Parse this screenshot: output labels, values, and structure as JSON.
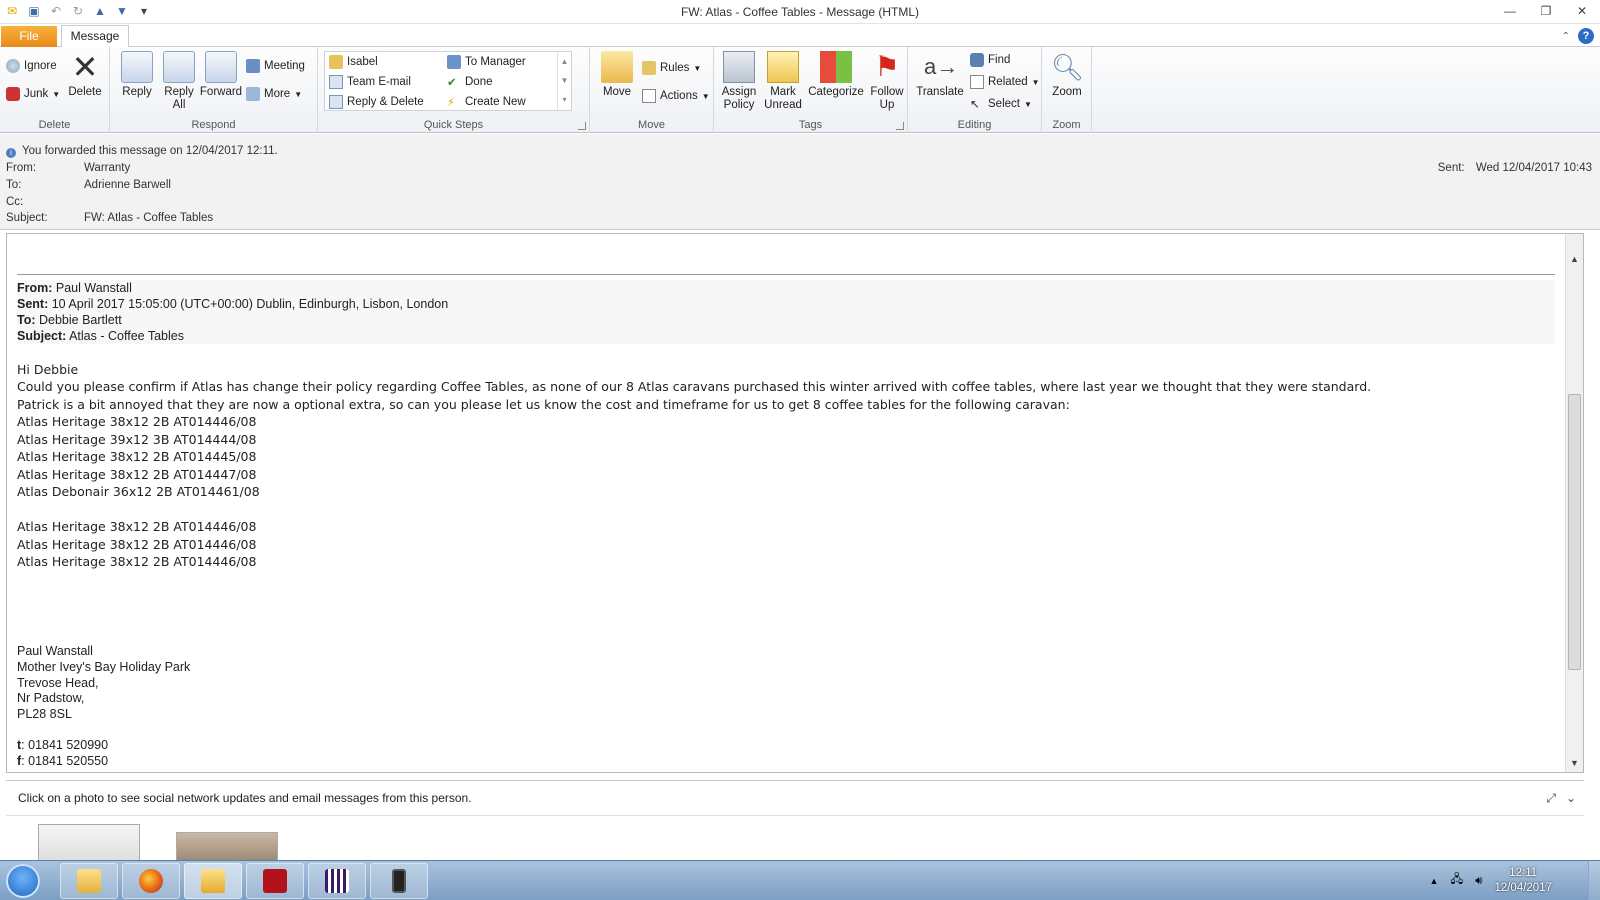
{
  "window": {
    "title": "FW: Atlas - Coffee Tables  -  Message (HTML)"
  },
  "ribbon": {
    "tabs": {
      "file": "File",
      "message": "Message"
    },
    "groups": {
      "delete": {
        "label": "Delete",
        "ignore": "Ignore",
        "junk": "Junk",
        "delete": "Delete"
      },
      "respond": {
        "label": "Respond",
        "reply": "Reply",
        "reply_all_1": "Reply",
        "reply_all_2": "All",
        "forward": "Forward",
        "meeting": "Meeting",
        "more": "More"
      },
      "quick_steps": {
        "label": "Quick Steps",
        "items": [
          "Isabel",
          "Team E-mail",
          "Reply & Delete",
          "To Manager",
          "Done",
          "Create New"
        ]
      },
      "move": {
        "label": "Move",
        "move": "Move",
        "rules": "Rules",
        "actions": "Actions"
      },
      "tags": {
        "label": "Tags",
        "assign_1": "Assign",
        "assign_2": "Policy",
        "mark_1": "Mark",
        "mark_2": "Unread",
        "categorize": "Categorize",
        "follow_1": "Follow",
        "follow_2": "Up"
      },
      "editing": {
        "label": "Editing",
        "translate": "Translate",
        "find": "Find",
        "related": "Related",
        "select": "Select"
      },
      "zoom": {
        "label": "Zoom",
        "zoom": "Zoom"
      }
    }
  },
  "header": {
    "info": "You forwarded this message on 12/04/2017 12:11.",
    "from_label": "From:",
    "from": "Warranty",
    "to_label": "To:",
    "to": "Adrienne Barwell",
    "cc_label": "Cc:",
    "subject_label": "Subject:",
    "subject": "FW: Atlas - Coffee Tables",
    "sent_label": "Sent:",
    "sent": "Wed 12/04/2017 10:43"
  },
  "message": {
    "fwd": {
      "from_label": "From:",
      "from": " Paul Wanstall",
      "sent_label": "Sent:",
      "sent": " 10 April 2017 15:05:00 (UTC+00:00) Dublin, Edinburgh, Lisbon, London",
      "to_label": "To:",
      "to": " Debbie Bartlett",
      "subject_label": "Subject:",
      "subject": " Atlas - Coffee Tables"
    },
    "greeting": "Hi Debbie",
    "para1": "Could you please confirm if Atlas has change their policy regarding Coffee Tables, as none of our 8 Atlas caravans purchased this winter arrived with coffee tables, where last year we thought that they were standard.",
    "para2": "Patrick is a bit annoyed that they are now a optional extra, so can you please let us know the cost and timeframe for us to get 8 coffee tables for the following caravan:",
    "list1": [
      "Atlas Heritage 38x12 2B AT014446/08",
      "Atlas Heritage 39x12 3B AT014444/08",
      "Atlas Heritage 38x12 2B AT014445/08",
      "Atlas Heritage 38x12 2B AT014447/08",
      "Atlas Debonair 36x12 2B AT014461/08"
    ],
    "list2": [
      "Atlas Heritage 38x12 2B AT014446/08",
      "Atlas Heritage 38x12 2B AT014446/08",
      "Atlas Heritage 38x12 2B AT014446/08"
    ],
    "signature": [
      "Paul Wanstall",
      "Mother Ivey's Bay Holiday Park",
      "Trevose Head,",
      "Nr Padstow,",
      "PL28 8SL"
    ],
    "phone_label": "t",
    "phone": ": 01841 520990",
    "fax_label": "f",
    "fax": ": 01841 520550"
  },
  "people_pane": {
    "message": "Click on a photo to see social network updates and email messages from this person."
  },
  "taskbar": {
    "time": "12:11",
    "date": "12/04/2017"
  }
}
